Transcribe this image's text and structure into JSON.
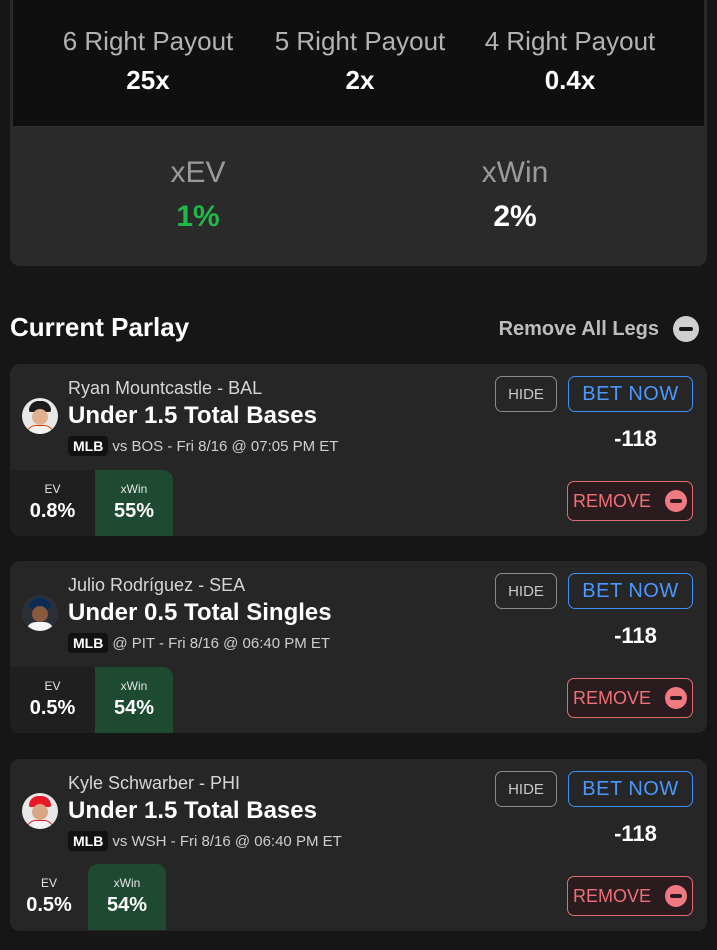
{
  "payouts": [
    {
      "label": "6 Right Payout",
      "value": "25x"
    },
    {
      "label": "5 Right Payout",
      "value": "2x"
    },
    {
      "label": "4 Right Payout",
      "value": "0.4x"
    }
  ],
  "stats": {
    "xev_label": "xEV",
    "xev_value": "1%",
    "xev_color": "#1fb94a",
    "xwin_label": "xWin",
    "xwin_value": "2%"
  },
  "heading": {
    "title": "Current Parlay",
    "remove_all": "Remove All Legs"
  },
  "colors": {
    "accent_blue": "#3e8ef7",
    "remove_red": "#ef6f78",
    "xwin_green": "#1d4a30"
  },
  "legs": [
    {
      "player": "Ryan Mountcastle - BAL",
      "market": "Under 1.5 Total Bases",
      "league": "MLB",
      "matchup": "vs BOS - Fri 8/16 @ 07:05 PM ET",
      "hide": "HIDE",
      "bet": "BET NOW",
      "odds": "-118",
      "remove": "REMOVE",
      "ev_label": "EV",
      "ev_value": "0.8%",
      "xwin_label": "xWin",
      "xwin_value": "55%",
      "avatar_icon": "player-headshot-icon"
    },
    {
      "player": "Julio Rodríguez - SEA",
      "market": "Under 0.5 Total Singles",
      "league": "MLB",
      "matchup": "@ PIT - Fri 8/16 @ 06:40 PM ET",
      "hide": "HIDE",
      "bet": "BET NOW",
      "odds": "-118",
      "remove": "REMOVE",
      "ev_label": "EV",
      "ev_value": "0.5%",
      "xwin_label": "xWin",
      "xwin_value": "54%",
      "avatar_icon": "player-headshot-icon"
    },
    {
      "player": "Kyle Schwarber - PHI",
      "market": "Under 1.5 Total Bases",
      "league": "MLB",
      "matchup": "vs WSH - Fri 8/16 @ 06:40 PM ET",
      "hide": "HIDE",
      "bet": "BET NOW",
      "odds": "-118",
      "remove": "REMOVE",
      "ev_label": "EV",
      "ev_value": "0.5%",
      "xwin_label": "xWin",
      "xwin_value": "54%",
      "avatar_icon": "player-headshot-icon"
    }
  ]
}
